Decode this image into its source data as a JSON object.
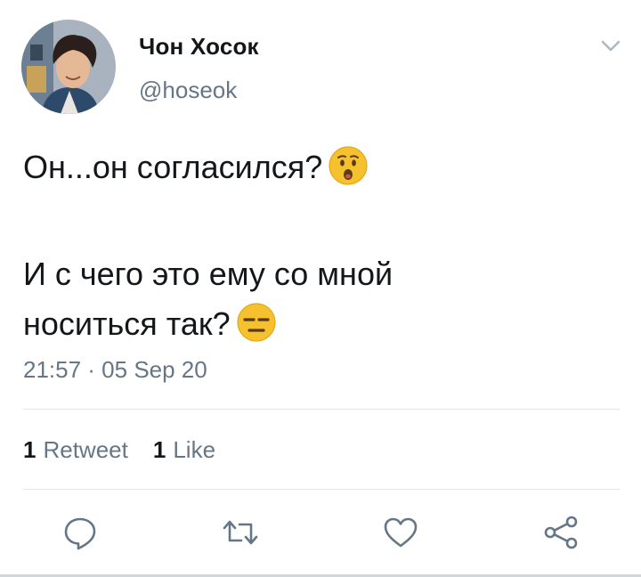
{
  "author": {
    "display_name": "Чон Хосок",
    "handle": "@hoseok"
  },
  "tweet": {
    "line1": "Он...он согласился?",
    "line1_emoji": "hushed-face",
    "line2a": "И с чего это ему со мной",
    "line2b": "носиться так?",
    "line2_emoji": "expressionless-face",
    "timestamp": "21:57 · 05 Sep 20"
  },
  "stats": {
    "retweets_count": "1",
    "retweets_label": "Retweet",
    "likes_count": "1",
    "likes_label": "Like"
  },
  "actions": [
    "reply-icon",
    "retweet-icon",
    "like-icon",
    "share-icon"
  ],
  "colors": {
    "text": "#14171a",
    "secondary": "#657786",
    "icon": "#657786",
    "divider": "#e1e8ed",
    "emoji_yellow": "#f5c12e"
  }
}
